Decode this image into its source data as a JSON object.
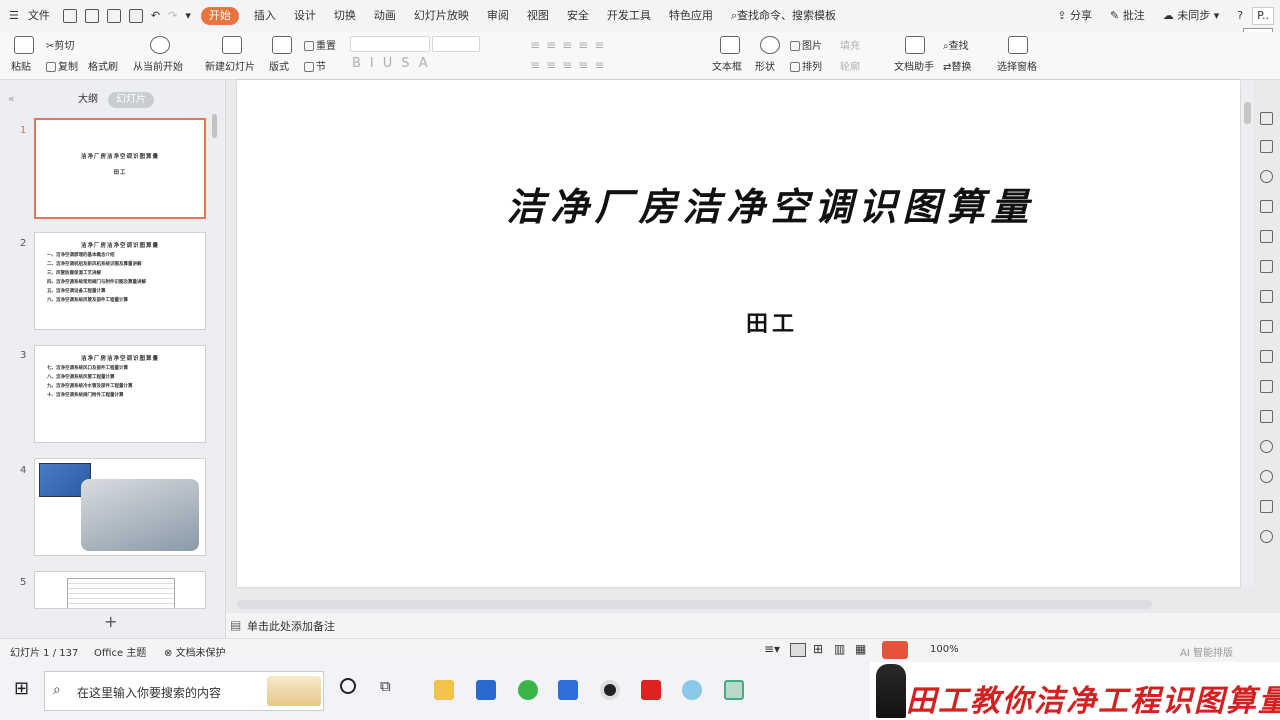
{
  "menubar": {
    "file": "文件",
    "tabs": [
      "开始",
      "插入",
      "设计",
      "切换",
      "动画",
      "幻灯片放映",
      "审阅",
      "视图",
      "安全",
      "开发工具",
      "特色应用"
    ],
    "search": "查找命令、搜索模板",
    "share": "分享",
    "comment": "批注",
    "sync": "未同步",
    "tooltip": "开始"
  },
  "ribbon": {
    "paste": "粘贴",
    "cut": "剪切",
    "copy": "复制",
    "format_painter": "格式刷",
    "from_current": "从当前开始",
    "new_slide": "新建幻灯片",
    "layout": "版式",
    "reset": "重置",
    "section": "节",
    "textbox": "文本框",
    "shape": "形状",
    "picture": "图片",
    "fill": "填充",
    "arrange": "排列",
    "outline": "轮廓",
    "doc_assistant": "文档助手",
    "find": "查找",
    "replace": "替换",
    "select_pane": "选择窗格"
  },
  "leftpanel": {
    "tab_outline": "大纲",
    "tab_slides": "幻灯片",
    "slides": [
      {
        "num": "1",
        "title": "洁净厂房洁净空调识图算量",
        "lines": [
          "田工"
        ]
      },
      {
        "num": "2",
        "title": "洁净厂房洁净空调识图算量",
        "lines": [
          "一、洁净空调原理的基本概念介绍",
          "二、洁净空调机组及新风机系统识图及算量讲解",
          "三、风管防腐保温工艺讲解",
          "四、洁净空调系统常用阀门与附件识图及算量讲解",
          "五、洁净空调设备工程量计算",
          "六、洁净空调系统风管及部件工程量计算"
        ]
      },
      {
        "num": "3",
        "title": "洁净厂房洁净空调识图算量",
        "lines": [
          "七、洁净空调系统风口及部件工程量计算",
          "八、洁净空调系统风管工程量计算",
          "九、洁净空调系统冷水管及部件工程量计算",
          "十、洁净空调系统阀门附件工程量计算"
        ]
      },
      {
        "num": "4",
        "title": "",
        "lines": []
      },
      {
        "num": "5",
        "title": "",
        "lines": []
      }
    ],
    "add": "+"
  },
  "slide": {
    "title": "洁净厂房洁净空调识图算量",
    "subtitle": "田工"
  },
  "notes": {
    "placeholder": "单击此处添加备注"
  },
  "status": {
    "slide_count": "幻灯片 1 / 137",
    "theme": "Office 主题",
    "protection": "文档未保护",
    "zoom": "100%",
    "smart": "AI 智能排版"
  },
  "taskbar": {
    "search": "在这里输入你要搜索的内容"
  },
  "banner": {
    "text": "田工教你洁净工程识图算量"
  },
  "colors": {
    "accent": "#e8733d",
    "banner_red": "#d42020"
  }
}
